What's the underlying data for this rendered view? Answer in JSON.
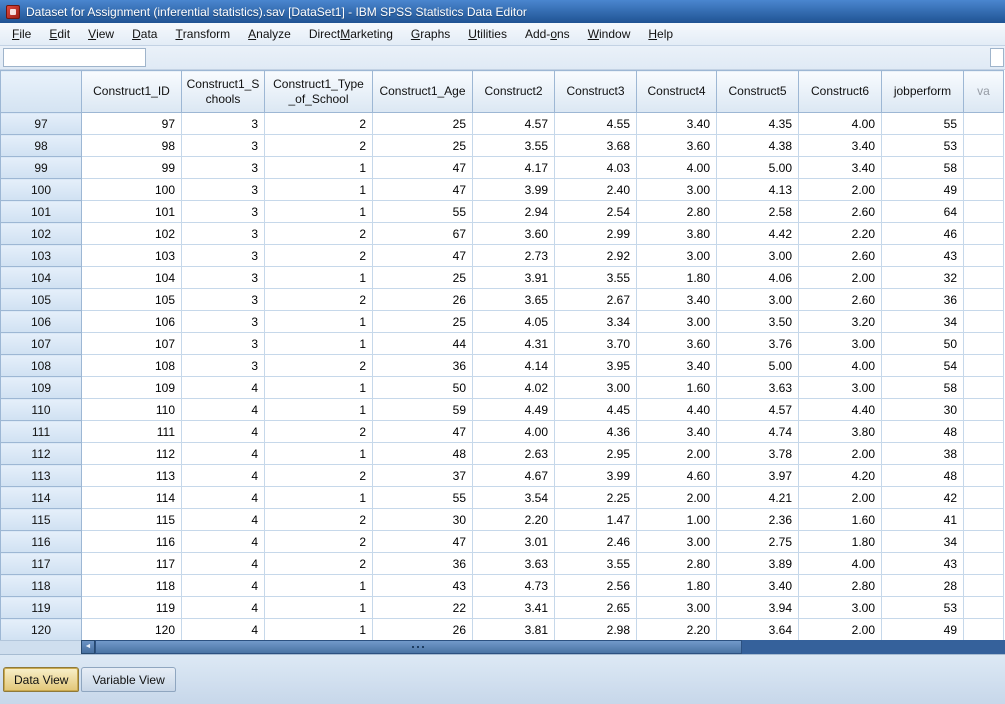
{
  "window": {
    "title": "Dataset for Assignment (inferential statistics).sav [DataSet1] - IBM SPSS Statistics Data Editor"
  },
  "menu": {
    "items": [
      {
        "label": "File",
        "u": 0
      },
      {
        "label": "Edit",
        "u": 0
      },
      {
        "label": "View",
        "u": 0
      },
      {
        "label": "Data",
        "u": 0
      },
      {
        "label": "Transform",
        "u": 0
      },
      {
        "label": "Analyze",
        "u": 0
      },
      {
        "label": "Direct Marketing",
        "u": 7
      },
      {
        "label": "Graphs",
        "u": 0
      },
      {
        "label": "Utilities",
        "u": 0
      },
      {
        "label": "Add-ons",
        "u": 4
      },
      {
        "label": "Window",
        "u": 0
      },
      {
        "label": "Help",
        "u": 0
      }
    ]
  },
  "toolbar": {
    "cell_editor_value": ""
  },
  "table": {
    "columns": [
      {
        "label": "Construct1_ID"
      },
      {
        "label": "Construct1_S\nchools"
      },
      {
        "label": "Construct1_Type\n_of_School"
      },
      {
        "label": "Construct1_Age"
      },
      {
        "label": "Construct2"
      },
      {
        "label": "Construct3"
      },
      {
        "label": "Construct4"
      },
      {
        "label": "Construct5"
      },
      {
        "label": "Construct6"
      },
      {
        "label": "jobperform"
      },
      {
        "label": "va",
        "placeholder": true
      }
    ],
    "rows": [
      {
        "num": "97",
        "values": [
          "97",
          "3",
          "2",
          "25",
          "4.57",
          "4.55",
          "3.40",
          "4.35",
          "4.00",
          "55"
        ]
      },
      {
        "num": "98",
        "values": [
          "98",
          "3",
          "2",
          "25",
          "3.55",
          "3.68",
          "3.60",
          "4.38",
          "3.40",
          "53"
        ]
      },
      {
        "num": "99",
        "values": [
          "99",
          "3",
          "1",
          "47",
          "4.17",
          "4.03",
          "4.00",
          "5.00",
          "3.40",
          "58"
        ]
      },
      {
        "num": "100",
        "values": [
          "100",
          "3",
          "1",
          "47",
          "3.99",
          "2.40",
          "3.00",
          "4.13",
          "2.00",
          "49"
        ]
      },
      {
        "num": "101",
        "values": [
          "101",
          "3",
          "1",
          "55",
          "2.94",
          "2.54",
          "2.80",
          "2.58",
          "2.60",
          "64"
        ]
      },
      {
        "num": "102",
        "values": [
          "102",
          "3",
          "2",
          "67",
          "3.60",
          "2.99",
          "3.80",
          "4.42",
          "2.20",
          "46"
        ]
      },
      {
        "num": "103",
        "values": [
          "103",
          "3",
          "2",
          "47",
          "2.73",
          "2.92",
          "3.00",
          "3.00",
          "2.60",
          "43"
        ]
      },
      {
        "num": "104",
        "values": [
          "104",
          "3",
          "1",
          "25",
          "3.91",
          "3.55",
          "1.80",
          "4.06",
          "2.00",
          "32"
        ]
      },
      {
        "num": "105",
        "values": [
          "105",
          "3",
          "2",
          "26",
          "3.65",
          "2.67",
          "3.40",
          "3.00",
          "2.60",
          "36"
        ]
      },
      {
        "num": "106",
        "values": [
          "106",
          "3",
          "1",
          "25",
          "4.05",
          "3.34",
          "3.00",
          "3.50",
          "3.20",
          "34"
        ]
      },
      {
        "num": "107",
        "values": [
          "107",
          "3",
          "1",
          "44",
          "4.31",
          "3.70",
          "3.60",
          "3.76",
          "3.00",
          "50"
        ]
      },
      {
        "num": "108",
        "values": [
          "108",
          "3",
          "2",
          "36",
          "4.14",
          "3.95",
          "3.40",
          "5.00",
          "4.00",
          "54"
        ]
      },
      {
        "num": "109",
        "values": [
          "109",
          "4",
          "1",
          "50",
          "4.02",
          "3.00",
          "1.60",
          "3.63",
          "3.00",
          "58"
        ]
      },
      {
        "num": "110",
        "values": [
          "110",
          "4",
          "1",
          "59",
          "4.49",
          "4.45",
          "4.40",
          "4.57",
          "4.40",
          "30"
        ]
      },
      {
        "num": "111",
        "values": [
          "111",
          "4",
          "2",
          "47",
          "4.00",
          "4.36",
          "3.40",
          "4.74",
          "3.80",
          "48"
        ]
      },
      {
        "num": "112",
        "values": [
          "112",
          "4",
          "1",
          "48",
          "2.63",
          "2.95",
          "2.00",
          "3.78",
          "2.00",
          "38"
        ]
      },
      {
        "num": "113",
        "values": [
          "113",
          "4",
          "2",
          "37",
          "4.67",
          "3.99",
          "4.60",
          "3.97",
          "4.20",
          "48"
        ]
      },
      {
        "num": "114",
        "values": [
          "114",
          "4",
          "1",
          "55",
          "3.54",
          "2.25",
          "2.00",
          "4.21",
          "2.00",
          "42"
        ]
      },
      {
        "num": "115",
        "values": [
          "115",
          "4",
          "2",
          "30",
          "2.20",
          "1.47",
          "1.00",
          "2.36",
          "1.60",
          "41"
        ]
      },
      {
        "num": "116",
        "values": [
          "116",
          "4",
          "2",
          "47",
          "3.01",
          "2.46",
          "3.00",
          "2.75",
          "1.80",
          "34"
        ]
      },
      {
        "num": "117",
        "values": [
          "117",
          "4",
          "2",
          "36",
          "3.63",
          "3.55",
          "2.80",
          "3.89",
          "4.00",
          "43"
        ]
      },
      {
        "num": "118",
        "values": [
          "118",
          "4",
          "1",
          "43",
          "4.73",
          "2.56",
          "1.80",
          "3.40",
          "2.80",
          "28"
        ]
      },
      {
        "num": "119",
        "values": [
          "119",
          "4",
          "1",
          "22",
          "3.41",
          "2.65",
          "3.00",
          "3.94",
          "3.00",
          "53"
        ]
      },
      {
        "num": "120",
        "values": [
          "120",
          "4",
          "1",
          "26",
          "3.81",
          "2.98",
          "2.20",
          "3.64",
          "2.00",
          "49"
        ]
      }
    ]
  },
  "tabs": [
    {
      "label": "Data View",
      "active": true
    },
    {
      "label": "Variable View",
      "active": false
    }
  ],
  "colors": {
    "title_bar": "#2d66ad",
    "menu_bar": "#eef3fa",
    "grid_line": "#c6d8ea",
    "column_header_fill": "#e4edf6",
    "row_header_fill": "#d9e6f4",
    "scrollbar_track": "#35619b",
    "active_tab_fill": "#ecd38a",
    "inactive_tab_fill": "#d3dfed"
  }
}
